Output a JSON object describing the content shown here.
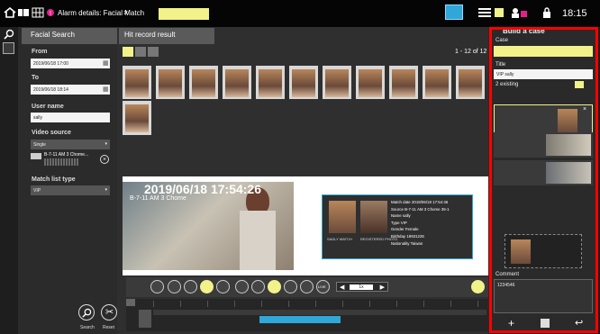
{
  "topbar": {
    "tab_title": "Alarm details: Facial Match",
    "time": "18:15"
  },
  "left": {
    "header": "Facial Search",
    "from_label": "From",
    "from_value": "2019/06/18 17:00",
    "to_label": "To",
    "to_value": "2019/06/18 18:14",
    "user_label": "User name",
    "user_value": "sally",
    "video_label": "Video source",
    "video_value": "Single",
    "camera_name": "B-7-11 AM 3 Chome...",
    "match_label": "Match list type",
    "match_value": "VIP",
    "search": "Search",
    "reset": "Reset"
  },
  "center": {
    "header": "Hit record result",
    "count": "1 - 12 of 12",
    "overlay_date": "2019/06/18 17:54:26",
    "overlay_cam": "B-7-11 AM 3 Chome",
    "detail": {
      "match_date": "Match date  2019/06/18 17:54:46",
      "source": "Source  B-7-11 AM 3 Chome 35-1",
      "name": "Name  sally",
      "type": "Type  VIP",
      "gender": "Gender  Female",
      "birthday": "Birthday  19931226",
      "nationality": "Nationality  Taiwan",
      "cap_left": "SADLY MATCH",
      "cap_right": "REGISTERED PHOTO"
    },
    "live": "LIVE",
    "speed": "1x"
  },
  "right": {
    "header": "Build a case",
    "case_label": "Case",
    "title_label": "Title",
    "title_value": "VIP sally",
    "existing": "2 existing",
    "comment_label": "Comment",
    "comment_value": "1234546"
  }
}
